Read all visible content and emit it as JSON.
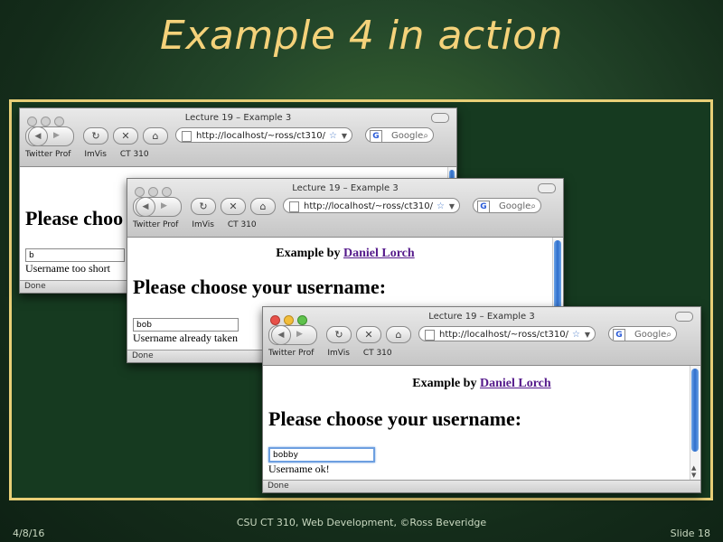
{
  "slide": {
    "title": "Example 4 in action",
    "date": "4/8/16",
    "footer": "CSU CT 310, Web Development, ©Ross Beveridge",
    "slide_number": "Slide 18"
  },
  "colors": {
    "title_gold": "#f4d27a",
    "frame_gold": "#e8cf77",
    "visited_link": "#551a8b"
  },
  "windows": [
    {
      "title": "Lecture 19 – Example 3",
      "url": "http://localhost/~ross/ct310/",
      "search_placeholder": "Google",
      "bookmarks": [
        "Twitter Prof",
        "ImVis",
        "CT 310"
      ],
      "credit_prefix": "",
      "credit_link": "",
      "heading": "Please choo",
      "input_value": "b",
      "message": "Username too short",
      "status": "Done"
    },
    {
      "title": "Lecture 19 – Example 3",
      "url": "http://localhost/~ross/ct310/",
      "search_placeholder": "Google",
      "bookmarks": [
        "Twitter Prof",
        "ImVis",
        "CT 310"
      ],
      "credit_prefix": "Example by ",
      "credit_link": "Daniel Lorch",
      "heading": "Please choose your username:",
      "input_value": "bob",
      "message": "Username already taken",
      "status": "Done"
    },
    {
      "title": "Lecture 19 – Example 3",
      "url": "http://localhost/~ross/ct310/",
      "search_placeholder": "Google",
      "bookmarks": [
        "Twitter Prof",
        "ImVis",
        "CT 310"
      ],
      "credit_prefix": "Example by ",
      "credit_link": "Daniel Lorch",
      "heading": "Please choose your username:",
      "input_value": "bobby",
      "message": "Username ok!",
      "status": "Done"
    }
  ]
}
